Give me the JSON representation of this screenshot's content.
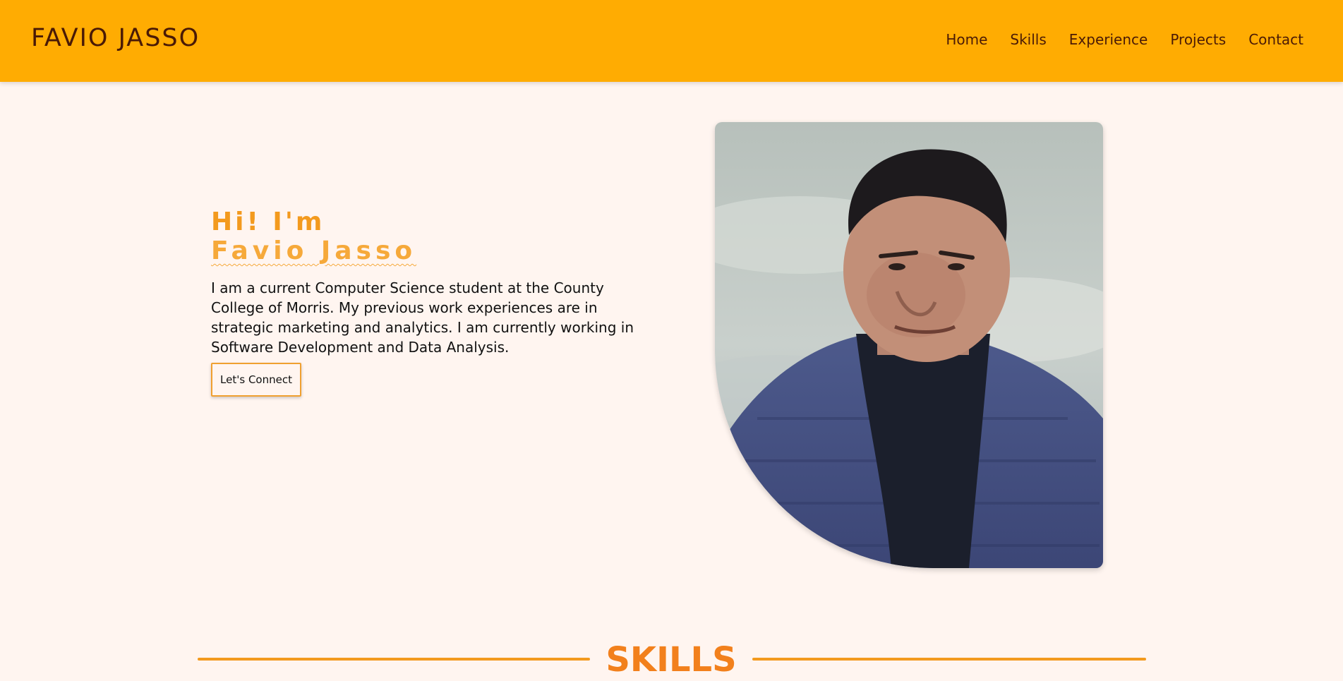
{
  "header": {
    "brand": "FAVIO JASSO",
    "nav": [
      {
        "label": "Home"
      },
      {
        "label": "Skills"
      },
      {
        "label": "Experience"
      },
      {
        "label": "Projects"
      },
      {
        "label": "Contact"
      }
    ]
  },
  "hero": {
    "greeting": "Hi! I'm",
    "name": "Favio Jasso",
    "bio": "I am a current Computer Science student at the County College of Morris. My previous work experiences are in strategic marketing and analytics. I am currently working in Software Development and Data Analysis.",
    "cta_label": "Let's Connect"
  },
  "skills": {
    "heading": "SKILLS"
  },
  "colors": {
    "header_bg": "#ffac02",
    "page_bg": "#fff5f0",
    "accent": "#f39a1e",
    "brand_text": "#4a1a06"
  }
}
